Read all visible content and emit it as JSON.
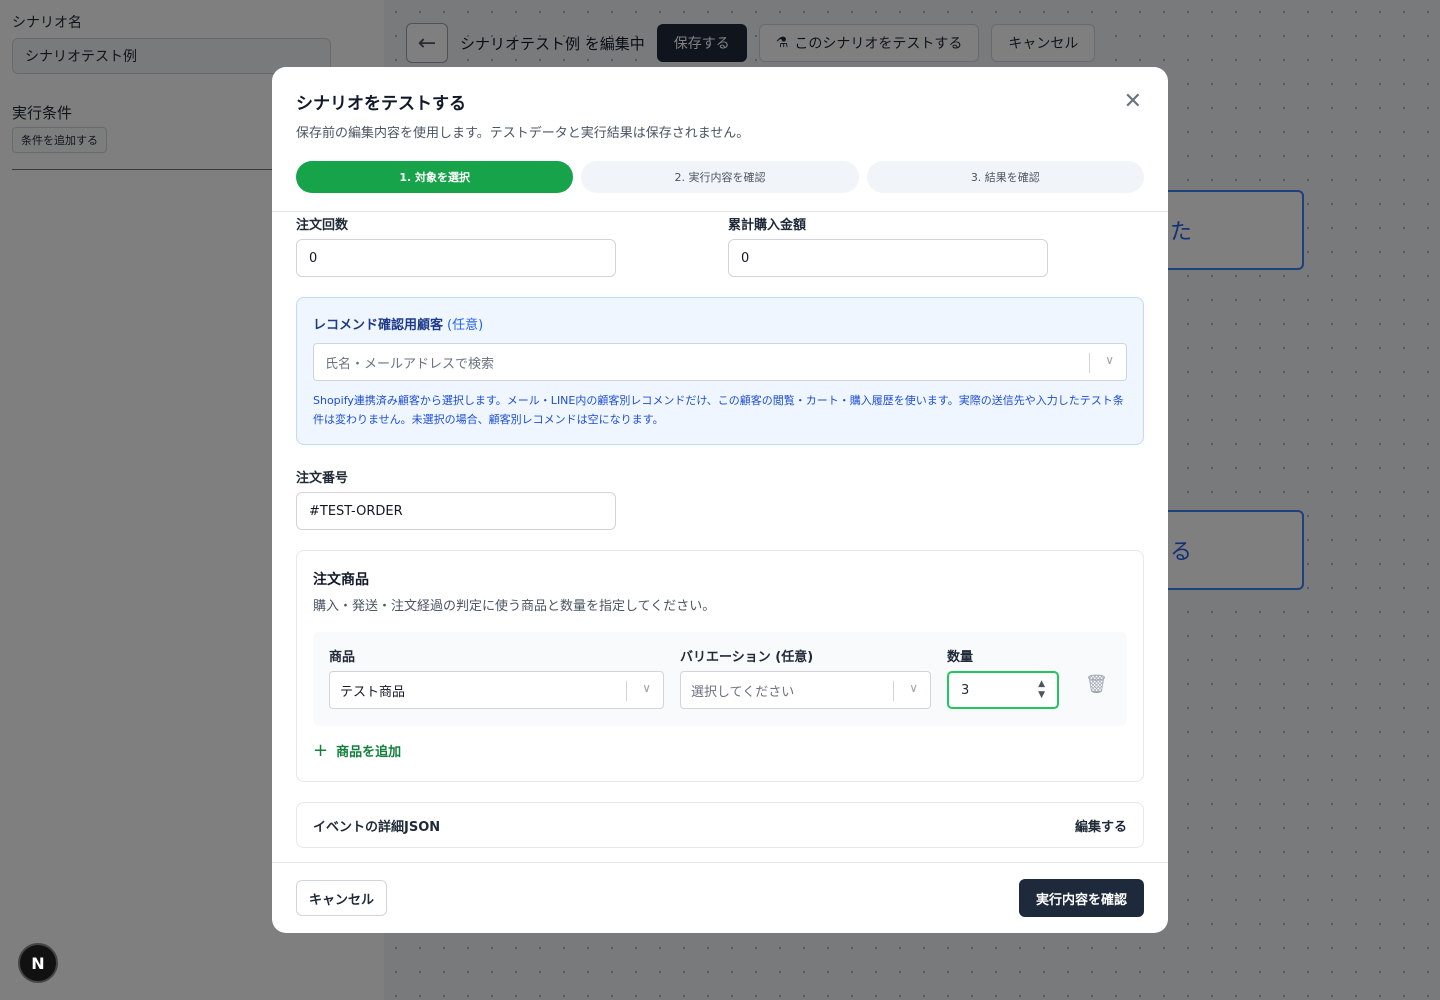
{
  "background": {
    "scenario_name_label": "シナリオ名",
    "scenario_name_value": "シナリオテスト例",
    "conditions_label": "実行条件",
    "add_condition_button": "条件を追加する",
    "back_icon": "arrow-left-icon",
    "editing_text": "シナリオテスト例 を編集中",
    "save_button": "保存する",
    "test_button": "このシナリオをテストする",
    "test_icon": "flask-icon",
    "cancel_button": "キャンセル",
    "node1_partial_text": "た",
    "node2_partial_text": "る",
    "next_badge": "N"
  },
  "modal": {
    "title": "シナリオをテストする",
    "description": "保存前の編集内容を使用します。テストデータと実行結果は保存されません。",
    "close_icon": "close-icon",
    "steps": [
      {
        "label": "1. 対象を選択",
        "active": true
      },
      {
        "label": "2. 実行内容を確認",
        "active": false
      },
      {
        "label": "3. 結果を確認",
        "active": false
      }
    ],
    "order_count": {
      "label": "注文回数",
      "value": "0"
    },
    "total_purchase": {
      "label": "累計購入金額",
      "value": "0"
    },
    "recommend": {
      "title": "レコメンド確認用顧客",
      "optional": "(任意)",
      "placeholder": "氏名・メールアドレスで検索",
      "help": "Shopify連携済み顧客から選択します。メール・LINE内の顧客別レコメンドだけ、この顧客の閲覧・カート・購入履歴を使います。実際の送信先や入力したテスト条件は変わりません。未選択の場合、顧客別レコメンドは空になります。"
    },
    "order_number": {
      "label": "注文番号",
      "value": "#TEST-ORDER"
    },
    "items": {
      "title": "注文商品",
      "description": "購入・発送・注文経過の判定に使う商品と数量を指定してください。",
      "product_label": "商品",
      "product_value": "テスト商品",
      "variation_label": "バリエーション (任意)",
      "variation_placeholder": "選択してください",
      "quantity_label": "数量",
      "quantity_value": "3",
      "delete_icon": "trash-icon",
      "add_label": "商品を追加"
    },
    "event_json": {
      "label": "イベントの詳細JSON",
      "edit": "編集する"
    },
    "footer": {
      "cancel": "キャンセル",
      "confirm": "実行内容を確認"
    }
  }
}
